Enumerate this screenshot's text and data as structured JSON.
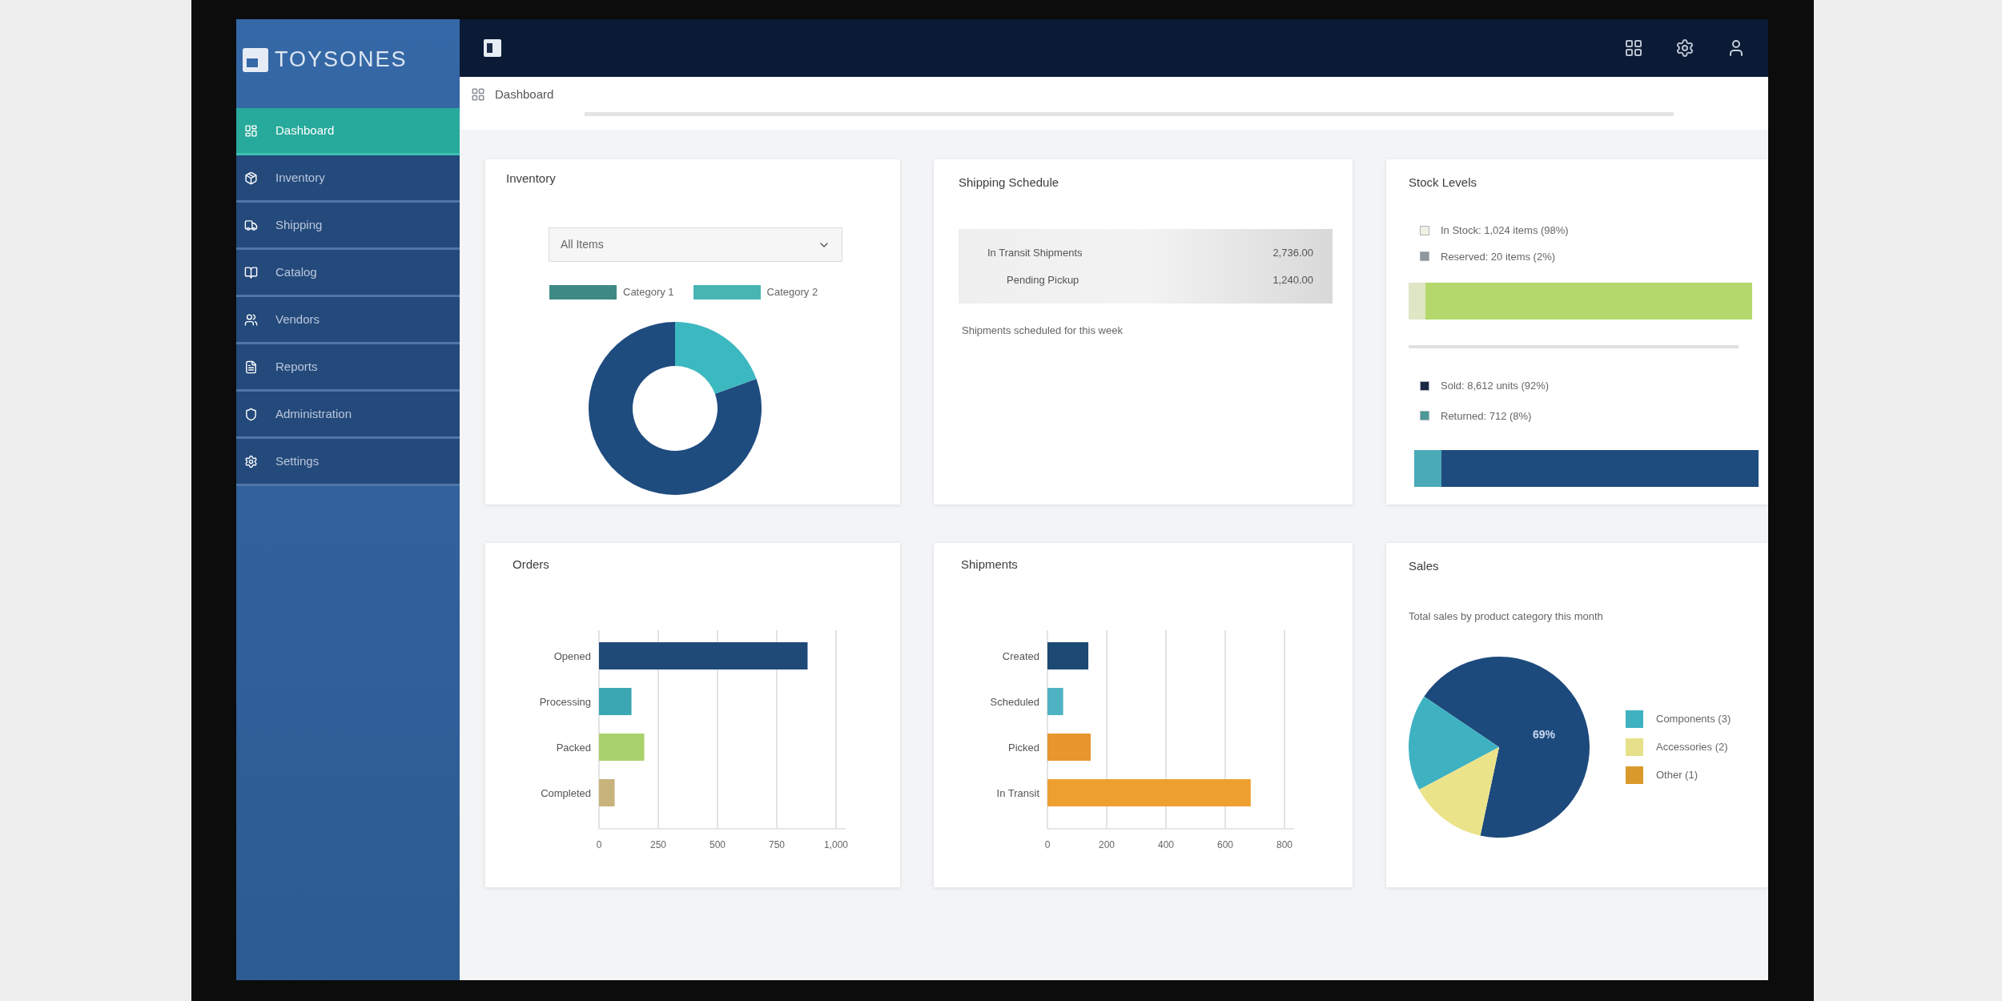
{
  "sidebar": {
    "logo": "TOYSONES",
    "items": [
      {
        "label": "Dashboard",
        "selected": true
      },
      {
        "label": "Inventory",
        "selected": false
      },
      {
        "label": "Shipping",
        "selected": false
      },
      {
        "label": "Catalog",
        "selected": false
      },
      {
        "label": "Vendors",
        "selected": false
      },
      {
        "label": "Reports",
        "selected": false
      },
      {
        "label": "Administration",
        "selected": false
      },
      {
        "label": "Settings",
        "selected": false
      }
    ]
  },
  "breadcrumb": {
    "label": "Dashboard"
  },
  "cards": [
    {
      "kind": "donut",
      "title": "Inventory",
      "select": {
        "value": "All Items"
      },
      "legend": [
        {
          "label": "Category 1",
          "color": "#3d8985"
        },
        {
          "label": "Category 2",
          "color": "#49b5b2"
        }
      ]
    },
    {
      "kind": "summary",
      "title": "Shipping Schedule",
      "rows": [
        {
          "label": "In Transit Shipments",
          "value": "2,736.00"
        },
        {
          "label": "Pending Pickup",
          "value": "1,240.00"
        }
      ],
      "note": "Shipments scheduled for this week"
    },
    {
      "kind": "stock",
      "title": "Stock Levels",
      "groups": [
        {
          "legend": [
            {
              "label": "In Stock: 1,024 items (98%)",
              "color": "#eef1e4"
            },
            {
              "label": "Reserved: 20 items (2%)",
              "color": "#8f969c"
            }
          ],
          "segments": [
            {
              "color": "#dfe6c6",
              "level": 0.05
            },
            {
              "color": "#b4d86c",
              "level": 0.95
            }
          ]
        },
        {
          "legend": [
            {
              "label": "Sold: 8,612 units (92%)",
              "color": "#1b2a44"
            },
            {
              "label": "Returned: 712 (8%)",
              "color": "#4a9a9a"
            }
          ],
          "segments": [
            {
              "color": "#4aaab8",
              "level": 0.08
            },
            {
              "color": "#1f4c7f",
              "level": 0.92
            }
          ]
        }
      ]
    },
    {
      "kind": "bar_chart",
      "title": "Orders",
      "bars": [
        {
          "color": "#1f4a78"
        },
        {
          "color": "#3aa7b2"
        },
        {
          "color": "#a9d16d"
        },
        {
          "color": "#c9b37c"
        }
      ],
      "chart_data": {
        "type": "bar",
        "orientation": "horizontal",
        "grid": true,
        "categories": [
          "Opened",
          "Processing",
          "Packed",
          "Completed"
        ],
        "series": [
          {
            "values": [
              880,
              137,
              191,
              66
            ]
          }
        ],
        "xlim": [
          0,
          1000
        ],
        "xticks": [
          0,
          250,
          500,
          750,
          {
            "value": 1000,
            "label": "1,000"
          }
        ]
      }
    },
    {
      "kind": "bar_chart",
      "title": "Shipments",
      "bars": [
        {
          "color": "#1d4a75"
        },
        {
          "color": "#4fb3c4"
        },
        {
          "color": "#e8962e"
        },
        {
          "color": "#eda030"
        }
      ],
      "chart_data": {
        "type": "bar",
        "orientation": "horizontal",
        "grid": true,
        "categories": [
          "Created",
          "Scheduled",
          "Picked",
          "In Transit"
        ],
        "series": [
          {
            "values": [
              138,
              53,
              146,
              686
            ]
          }
        ],
        "xlim": [
          0,
          800
        ],
        "xticks": [
          0,
          200,
          400,
          600,
          800
        ]
      }
    },
    {
      "kind": "pie",
      "title": "Sales",
      "subtitle": "Total sales by product category this month",
      "slice_label": "69%",
      "legend": [
        {
          "label": "Components (3)",
          "color": "#3fb2c2"
        },
        {
          "label": "Accessories (2)",
          "color": "#e6e08a"
        },
        {
          "label": "Other (1)",
          "color": "#d99a2b"
        }
      ]
    }
  ]
}
